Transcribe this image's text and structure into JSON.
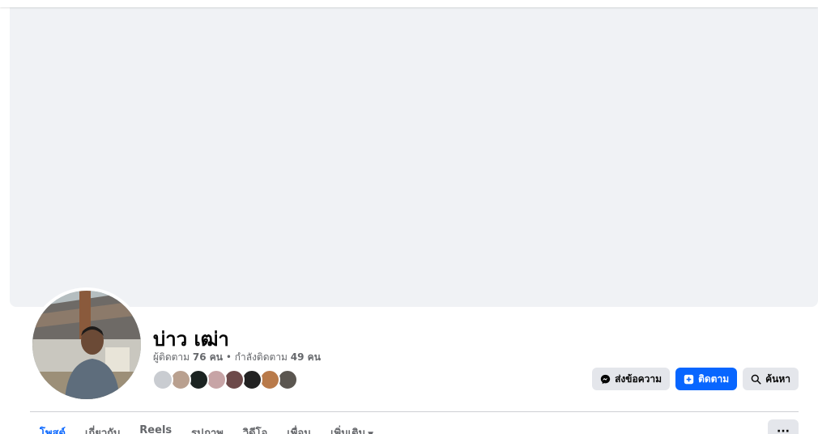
{
  "profile": {
    "name": "บ่าว เฒ่า",
    "followers_label": "ผู้ติดตาม",
    "followers_count": "76 คน",
    "separator": " • ",
    "following_label": "กำลังติดตาม",
    "following_count": "49 คน"
  },
  "friend_avatars": [
    {
      "name": "friend-1",
      "color": "#c9ccd1"
    },
    {
      "name": "friend-2",
      "color": "#b9a08f"
    },
    {
      "name": "friend-3",
      "color": "#1c2422"
    },
    {
      "name": "friend-4",
      "color": "#c7a4a6"
    },
    {
      "name": "friend-5",
      "color": "#6d4a4a"
    },
    {
      "name": "friend-6",
      "color": "#222222"
    },
    {
      "name": "friend-7",
      "color": "#b97a4a"
    },
    {
      "name": "friend-8",
      "color": "#5b5650"
    }
  ],
  "actions": {
    "message_label": "ส่งข้อความ",
    "follow_label": "ติดตาม",
    "search_label": "ค้นหา"
  },
  "tabs": [
    {
      "label": "โพสต์",
      "active": true
    },
    {
      "label": "เกี่ยวกับ",
      "active": false
    },
    {
      "label": "Reels",
      "active": false
    },
    {
      "label": "รูปภาพ",
      "active": false
    },
    {
      "label": "วิดีโอ",
      "active": false
    },
    {
      "label": "เพื่อน",
      "active": false
    },
    {
      "label": "เพิ่มเติม",
      "active": false
    }
  ],
  "more_button": "···",
  "colors": {
    "accent": "#0866ff",
    "cover": "#f0f2f5",
    "secondary_text": "#65676b"
  },
  "icons": {
    "message": "messenger-icon",
    "follow": "follow-plus-icon",
    "search": "search-icon",
    "more_tab": "caret-down-icon"
  }
}
